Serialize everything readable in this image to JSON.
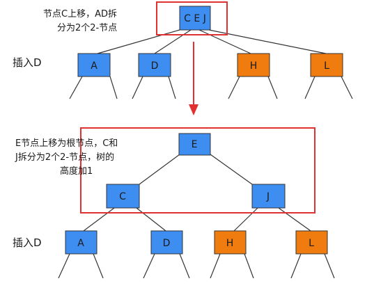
{
  "colors": {
    "blue_node": "#3d8ef0",
    "orange_node": "#f07c10",
    "highlight_frame": "#e03030",
    "edge": "#333333"
  },
  "top": {
    "annotation_lines": [
      "节点C上移，AD拆",
      "分为2个2-节点"
    ],
    "insert_label": "插入D",
    "root": {
      "label": "C E J",
      "color": "blue"
    },
    "children": [
      {
        "label": "A",
        "color": "blue"
      },
      {
        "label": "D",
        "color": "blue"
      },
      {
        "label": "H",
        "color": "orange"
      },
      {
        "label": "L",
        "color": "orange"
      }
    ]
  },
  "bottom": {
    "annotation_lines": [
      "E节点上移为根节点，C和",
      "J拆分为2个2-节点，树的",
      "高度加1"
    ],
    "insert_label": "插入D",
    "root": {
      "label": "E",
      "color": "blue"
    },
    "middle": [
      {
        "label": "C",
        "color": "blue"
      },
      {
        "label": "J",
        "color": "blue"
      }
    ],
    "leaves": [
      {
        "label": "A",
        "color": "blue"
      },
      {
        "label": "D",
        "color": "blue"
      },
      {
        "label": "H",
        "color": "orange"
      },
      {
        "label": "L",
        "color": "orange"
      }
    ]
  }
}
